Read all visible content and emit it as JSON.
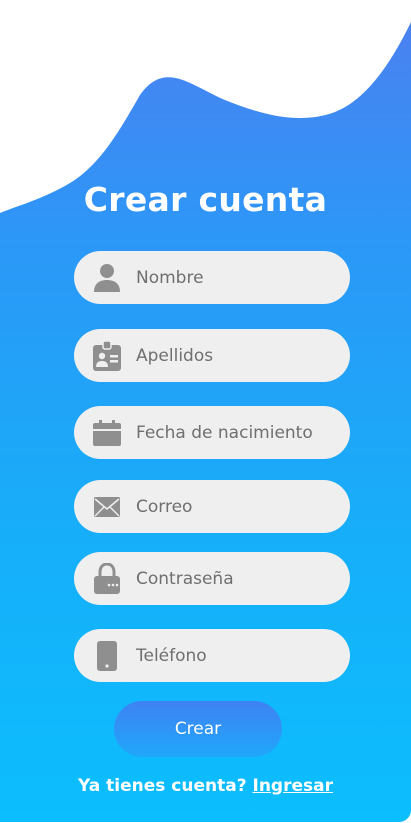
{
  "title": "Crear cuenta",
  "fields": {
    "nombre": {
      "placeholder": "Nombre",
      "icon": "person-icon"
    },
    "apellidos": {
      "placeholder": "Apellidos",
      "icon": "id-badge-icon"
    },
    "fecha": {
      "placeholder": "Fecha de nacimiento",
      "icon": "calendar-icon"
    },
    "correo": {
      "placeholder": "Correo",
      "icon": "envelope-icon"
    },
    "contrasena": {
      "placeholder": "Contraseña",
      "icon": "lock-icon"
    },
    "telefono": {
      "placeholder": "Teléfono",
      "icon": "phone-icon"
    }
  },
  "button": {
    "label": "Crear"
  },
  "footer": {
    "prompt": "Ya tienes cuenta?",
    "link": "Ingresar"
  },
  "colors": {
    "gradient_top": "#4d7ff0",
    "gradient_bottom": "#0bbefd",
    "field_bg": "#efefef",
    "icon": "#8f8f8f",
    "placeholder": "#6f6f6f"
  }
}
